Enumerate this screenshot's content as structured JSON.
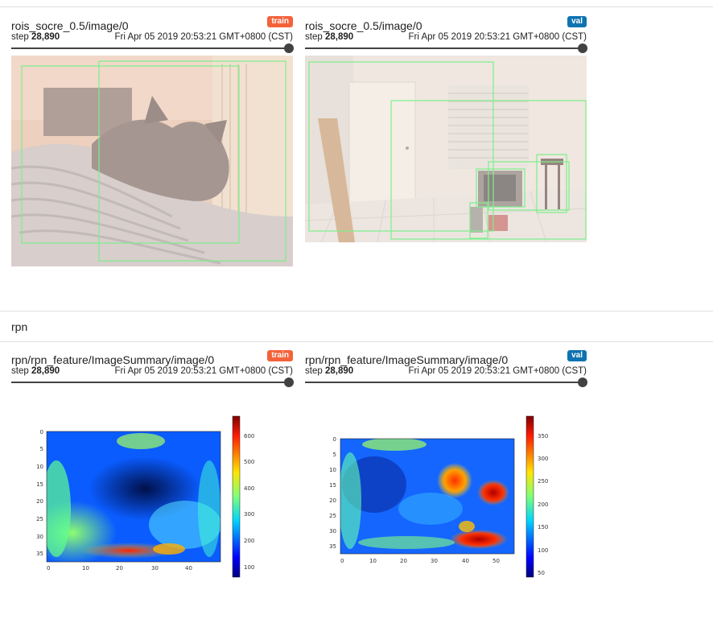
{
  "section": {
    "name": "rpn"
  },
  "cards": [
    {
      "title": "rois_socre_0.5/image/0",
      "tag": "train",
      "step_label": "step",
      "step": "28,890",
      "date": "Fri Apr 05 2019 20:53:21 GMT+0800 (CST)"
    },
    {
      "title": "rois_socre_0.5/image/0",
      "tag": "val",
      "step_label": "step",
      "step": "28,890",
      "date": "Fri Apr 05 2019 20:53:21 GMT+0800 (CST)"
    },
    {
      "title": "rpn/rpn_feature/ImageSummary/image/0",
      "tag": "train",
      "step_label": "step",
      "step": "28,890",
      "date": "Fri Apr 05 2019 20:53:21 GMT+0800 (CST)"
    },
    {
      "title": "rpn/rpn_feature/ImageSummary/image/0",
      "tag": "val",
      "step_label": "step",
      "step": "28,890",
      "date": "Fri Apr 05 2019 20:53:21 GMT+0800 (CST)"
    }
  ],
  "colors": {
    "train": "#f4623a",
    "val": "#0f73b0",
    "box": "#7cf08a"
  },
  "heatmaps": [
    {
      "xticks": [
        "0",
        "10",
        "20",
        "30",
        "40"
      ],
      "yticks": [
        "0",
        "5",
        "10",
        "15",
        "20",
        "25",
        "30",
        "35"
      ],
      "cbar_ticks": [
        "100",
        "200",
        "300",
        "400",
        "500",
        "600"
      ]
    },
    {
      "xticks": [
        "0",
        "10",
        "20",
        "30",
        "40",
        "50"
      ],
      "yticks": [
        "0",
        "5",
        "10",
        "15",
        "20",
        "25",
        "30",
        "35"
      ],
      "cbar_ticks": [
        "50",
        "100",
        "150",
        "200",
        "250",
        "300",
        "350"
      ]
    }
  ]
}
